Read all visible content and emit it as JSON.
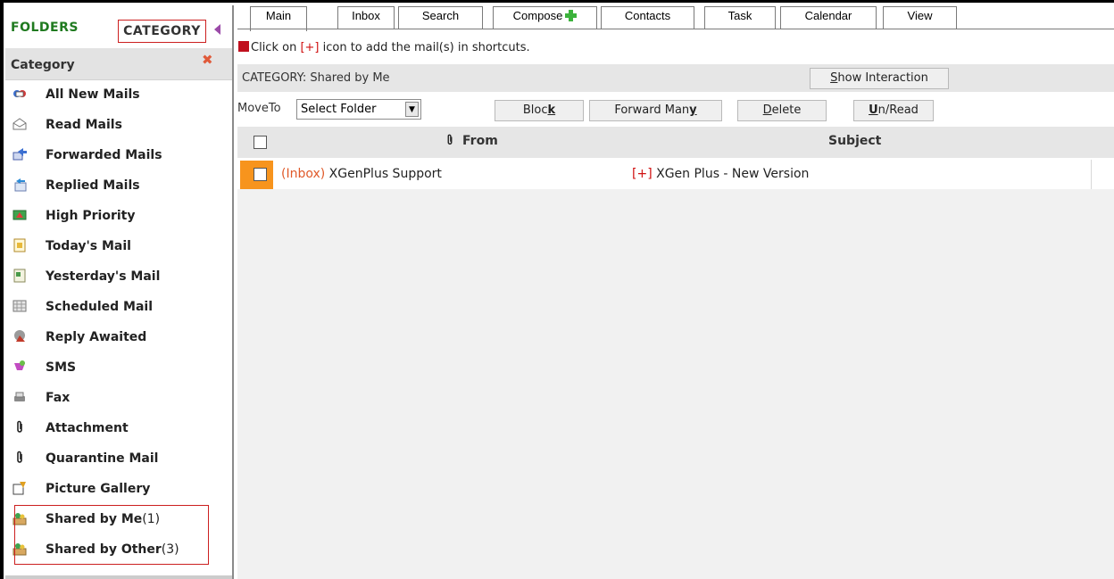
{
  "sidebar": {
    "tab_folders": "FOLDERS",
    "tab_category": "CATEGORY",
    "section_title": "Category",
    "close_glyph": "✖",
    "items": [
      {
        "label": "All New Mails",
        "icon": "new-mails-icon",
        "count": ""
      },
      {
        "label": "Read Mails",
        "icon": "read-mails-icon",
        "count": ""
      },
      {
        "label": "Forwarded Mails",
        "icon": "forwarded-mails-icon",
        "count": ""
      },
      {
        "label": "Replied Mails",
        "icon": "replied-mails-icon",
        "count": ""
      },
      {
        "label": "High Priority",
        "icon": "high-priority-icon",
        "count": ""
      },
      {
        "label": "Today's Mail",
        "icon": "todays-mail-icon",
        "count": ""
      },
      {
        "label": "Yesterday's Mail",
        "icon": "yesterdays-mail-icon",
        "count": ""
      },
      {
        "label": "Scheduled Mail",
        "icon": "scheduled-mail-icon",
        "count": ""
      },
      {
        "label": "Reply Awaited",
        "icon": "reply-awaited-icon",
        "count": ""
      },
      {
        "label": "SMS",
        "icon": "sms-icon",
        "count": ""
      },
      {
        "label": "Fax",
        "icon": "fax-icon",
        "count": ""
      },
      {
        "label": "Attachment",
        "icon": "paperclip-icon",
        "count": ""
      },
      {
        "label": "Quarantine Mail",
        "icon": "paperclip-icon",
        "count": ""
      },
      {
        "label": "Picture Gallery",
        "icon": "picture-gallery-icon",
        "count": ""
      },
      {
        "label": "Shared by Me",
        "icon": "shared-icon",
        "count": "(1)"
      },
      {
        "label": "Shared by Other",
        "icon": "shared-icon",
        "count": "(3)"
      }
    ]
  },
  "tabs": [
    {
      "label": "Main",
      "active": true
    },
    {
      "label": "Inbox"
    },
    {
      "label": "Search"
    },
    {
      "label": "Compose",
      "icon": "plus-icon"
    },
    {
      "label": "Contacts"
    },
    {
      "label": "Task"
    },
    {
      "label": "Calendar"
    },
    {
      "label": "View"
    }
  ],
  "info": {
    "prefix": "Click on ",
    "marker": "[+]",
    "suffix": " icon to add the mail(s) in shortcuts."
  },
  "category_bar": {
    "title": "CATEGORY: Shared by Me",
    "show_interaction_key": "S",
    "show_interaction_rest": "how Interaction"
  },
  "actions": {
    "moveto_label": "MoveTo",
    "select_value": "Select Folder",
    "block_pre": "Bloc",
    "block_key": "k",
    "forward_pre": "Forward Man",
    "forward_key": "y",
    "delete_key": "D",
    "delete_rest": "elete",
    "unread_key": "U",
    "unread_rest": "n/Read"
  },
  "table": {
    "col_attach_icon": "paperclip-icon",
    "col_from": "From",
    "col_subject": "Subject",
    "rows": [
      {
        "folder": "(Inbox)",
        "from": " XGenPlus Support",
        "marker": "[+]",
        "subject": " XGen Plus - New Version"
      }
    ]
  },
  "colors": {
    "folders_tab": "#1f7a1f",
    "highlight_box": "#cc1f1f",
    "row_marker": "#f7941d",
    "red_text": "#d01010",
    "header_bg": "#e6e6e6"
  }
}
